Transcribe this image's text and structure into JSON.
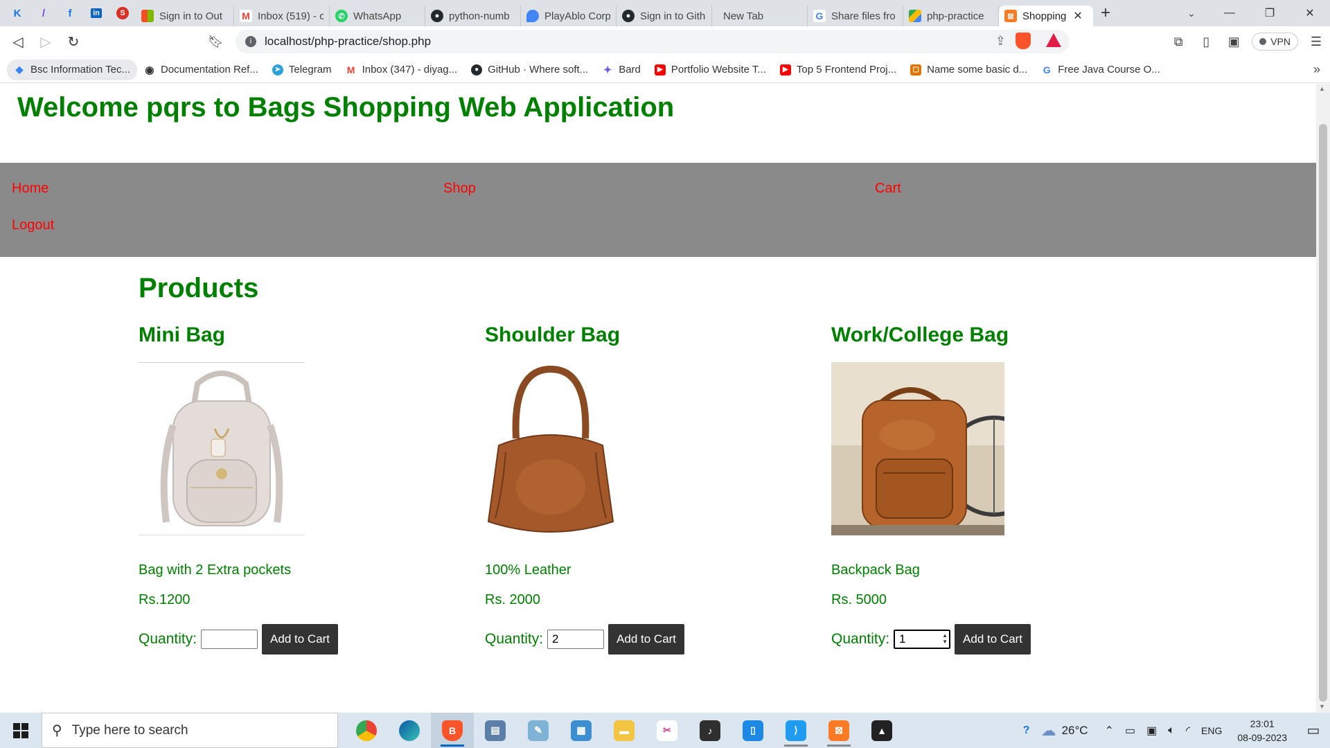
{
  "browser": {
    "pinned_tabs": [
      {
        "icon": "k-logo-icon",
        "color": "#1a73e8",
        "glyph": "K"
      },
      {
        "icon": "feather-icon",
        "color": "#7b3fe4",
        "glyph": "/"
      },
      {
        "icon": "facebook-icon",
        "color": "#1877f2",
        "glyph": "f"
      },
      {
        "icon": "linkedin-icon",
        "color": "#0a66c2",
        "glyph": "in"
      },
      {
        "icon": "stack-icon",
        "color": "#d93025",
        "glyph": "S"
      }
    ],
    "tabs": [
      {
        "title": "Sign in to Out",
        "icon": "microsoft-icon",
        "color": "#f25022"
      },
      {
        "title": "Inbox (519) - c",
        "icon": "gmail-icon",
        "color": "#ea4335"
      },
      {
        "title": "WhatsApp",
        "icon": "whatsapp-icon",
        "color": "#25d366"
      },
      {
        "title": "python-numb",
        "icon": "github-icon",
        "color": "#24292e"
      },
      {
        "title": "PlayAblo Corp",
        "icon": "maps-icon",
        "color": "#4285f4"
      },
      {
        "title": "Sign in to Gith",
        "icon": "github-icon",
        "color": "#24292e"
      },
      {
        "title": "New Tab",
        "icon": "blank-icon",
        "color": "#dee1e6"
      },
      {
        "title": "Share files fro",
        "icon": "google-icon",
        "color": "#4285f4"
      },
      {
        "title": "php-practice",
        "icon": "drive-icon",
        "color": "#fbbc04"
      },
      {
        "title": "Shopping",
        "icon": "xampp-icon",
        "color": "#fb7a24"
      }
    ],
    "url": "localhost/php-practice/shop.php",
    "vpn_label": "VPN",
    "bookmarks": [
      {
        "label": "Bsc Information Tec...",
        "icon": "diamond-icon",
        "color": "#3b82f6"
      },
      {
        "label": "Documentation Ref...",
        "icon": "globe-icon",
        "color": "#333333"
      },
      {
        "label": "Telegram",
        "icon": "telegram-icon",
        "color": "#2aa1da"
      },
      {
        "label": "Inbox (347) - diyag...",
        "icon": "gmail-icon",
        "color": "#ea4335"
      },
      {
        "label": "GitHub · Where soft...",
        "icon": "github-icon",
        "color": "#24292e"
      },
      {
        "label": "Bard",
        "icon": "bard-icon",
        "color": "#6f5ce8"
      },
      {
        "label": "Portfolio Website T...",
        "icon": "youtube-icon",
        "color": "#ff0000"
      },
      {
        "label": "Top 5 Frontend Proj...",
        "icon": "youtube-icon",
        "color": "#ff0000"
      },
      {
        "label": "Name some basic d...",
        "icon": "orange-box-icon",
        "color": "#e37400"
      },
      {
        "label": "Free Java Course O...",
        "icon": "g-icon",
        "color": "#4285f4"
      }
    ]
  },
  "page": {
    "welcome": "Welcome pqrs to Bags Shopping Web Application",
    "nav": {
      "home": "Home",
      "shop": "Shop",
      "cart": "Cart",
      "logout": "Logout"
    },
    "products_title": "Products",
    "quantity_label": "Quantity:",
    "add_label": "Add to Cart",
    "products": [
      {
        "name": "Mini Bag",
        "description": "Bag with 2 Extra pockets",
        "price": "Rs.1200",
        "quantity": ""
      },
      {
        "name": "Shoulder Bag",
        "description": "100% Leather",
        "price": "Rs. 2000",
        "quantity": "2"
      },
      {
        "name": "Work/College Bag",
        "description": "Backpack Bag",
        "price": "Rs. 5000",
        "quantity": "1"
      }
    ]
  },
  "taskbar": {
    "search_placeholder": "Type here to search",
    "weather": "26°C",
    "language": "ENG",
    "time": "23:01",
    "date": "08-09-2023"
  },
  "colors": {
    "heading_green": "#008000",
    "nav_red": "#ff0000",
    "navbar_gray": "#8a8a8a",
    "button_dark": "#333333"
  }
}
